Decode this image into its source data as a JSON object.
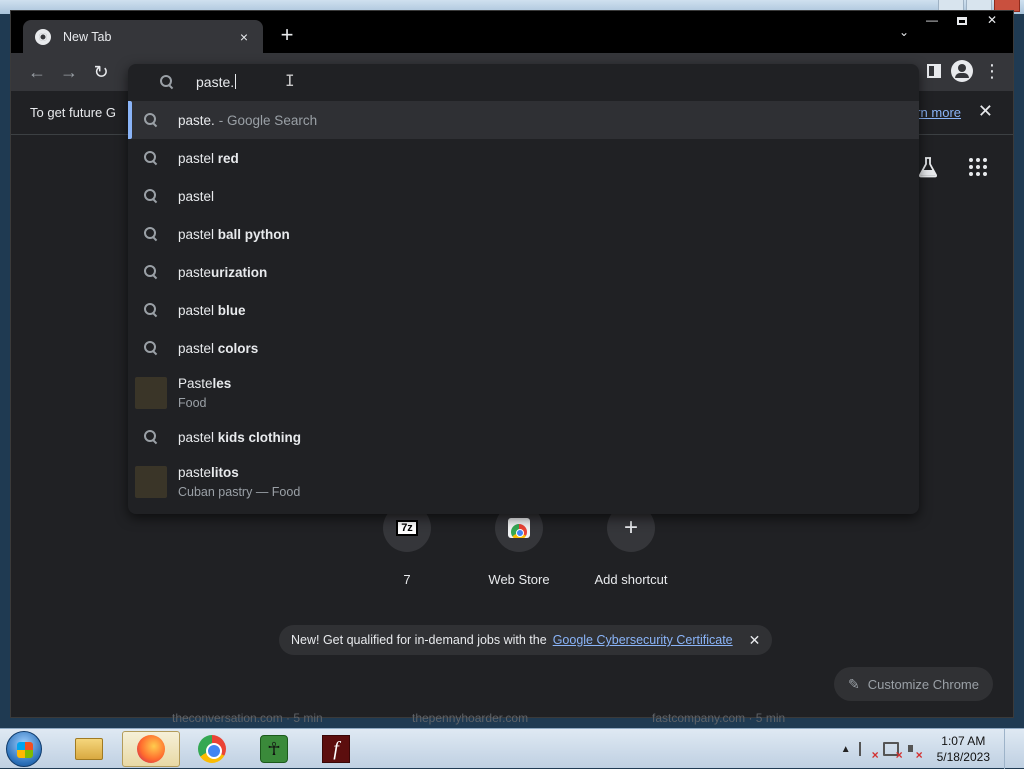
{
  "tab": {
    "title": "New Tab",
    "close_glyph": "×",
    "new_tab_glyph": "+"
  },
  "window_controls": {
    "minimize": "—",
    "close": "✕"
  },
  "toolbar": {
    "back_glyph": "←",
    "forward_glyph": "→",
    "reload_glyph": "↻",
    "menu_glyph": "⋮"
  },
  "omnibox": {
    "value": "paste.",
    "suggestions": [
      {
        "plain": "paste.",
        "bold": "",
        "hint": "- Google Search",
        "selected": true
      },
      {
        "plain": "pastel",
        "bold": " red"
      },
      {
        "plain": "pastel",
        "bold": ""
      },
      {
        "plain": "pastel",
        "bold": " ball python"
      },
      {
        "plain": "paste",
        "bold": "urization"
      },
      {
        "plain": "pastel",
        "bold": " blue"
      },
      {
        "plain": "pastel",
        "bold": " colors"
      },
      {
        "plain": "Paste",
        "bold": "les",
        "subtitle": "Food",
        "kind": "entity"
      },
      {
        "plain": "pastel",
        "bold": " kids clothing"
      },
      {
        "plain": "paste",
        "bold": "litos",
        "subtitle": "Cuban pastry — Food",
        "kind": "entity"
      }
    ]
  },
  "infobar": {
    "text": "To get future G",
    "link": "earn more",
    "close_glyph": "✕"
  },
  "shortcuts": [
    {
      "label": "7",
      "icon": "7z-icon"
    },
    {
      "label": "Web Store",
      "icon": "web-store-icon"
    },
    {
      "label": "Add shortcut",
      "icon": "plus-icon",
      "glyph": "+"
    }
  ],
  "promo": {
    "text": "New! Get qualified for in-demand jobs with the",
    "link": "Google Cybersecurity Certificate",
    "close_glyph": "✕"
  },
  "customize": {
    "label": "Customize Chrome",
    "icon_glyph": "✎"
  },
  "background_ghost_text": [
    "theconversation.com · 5 min",
    "thepennyhoarder.com",
    "fastcompany.com · 5 min"
  ],
  "taskbar": {
    "apps": [
      "windows-explorer",
      "firefox",
      "chrome",
      "app-green",
      "flash"
    ],
    "app_green_glyph": "☥",
    "flash_glyph": "f",
    "tray_up_glyph": "▲",
    "clock_time": "1:07 AM",
    "clock_date": "5/18/2023"
  },
  "colors": {
    "accent": "#8ab4f8",
    "bg": "#202124",
    "surface": "#35363a"
  }
}
